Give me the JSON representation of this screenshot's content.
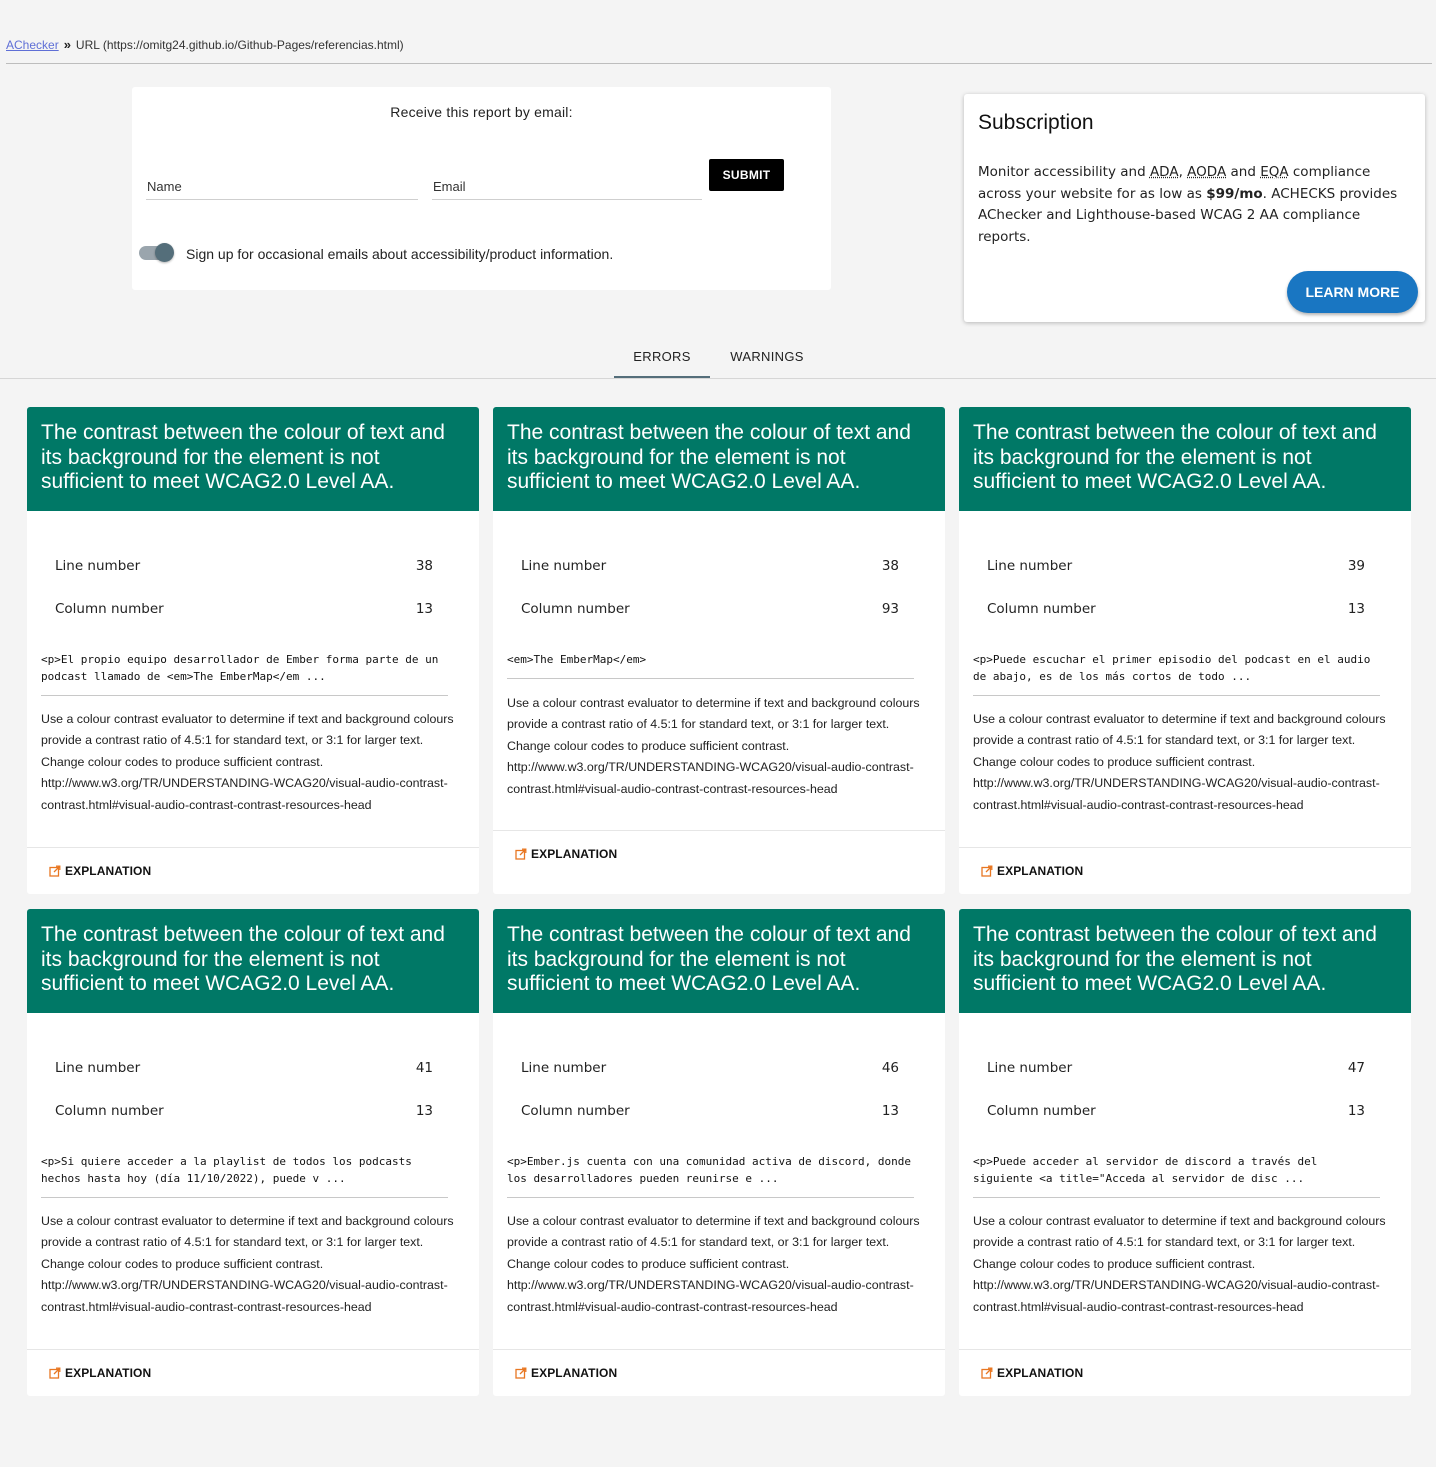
{
  "breadcrumb": {
    "link": "AChecker",
    "separator": "»",
    "current": "URL (https://omitg24.github.io/Github-Pages/referencias.html)"
  },
  "email_form": {
    "title": "Receive this report by email:",
    "name_placeholder": "Name",
    "email_placeholder": "Email",
    "submit_label": "SUBMIT",
    "toggle_label": "Sign up for occasional emails about accessibility/product information.",
    "toggle_on": true
  },
  "subscription": {
    "title": "Subscription",
    "text_before": "Monitor accessibility and ",
    "ada": "ADA",
    "comma": ", ",
    "aoda": "AODA",
    "and": " and ",
    "eqa": "EQA",
    "text_mid": " compliance across your website for as low as ",
    "price": "$99/mo",
    "text_after": ". ACHECKS provides AChecker and Lighthouse-based WCAG 2 AA compliance reports.",
    "button_label": "LEARN MORE"
  },
  "tabs": [
    {
      "label": "ERRORS",
      "active": true
    },
    {
      "label": "WARNINGS",
      "active": false
    }
  ],
  "colors": {
    "card_header": "#007866",
    "learn_more": "#1976c2",
    "explanation_icon": "#e87722"
  },
  "cards": [
    {
      "title": "The contrast between the colour of text and its background for the element is not sufficient to meet WCAG2.0 Level AA.",
      "line_label": "Line number",
      "line_value": "38",
      "col_label": "Column number",
      "col_value": "13",
      "code": "<p>El propio equipo desarrollador de Ember forma parte de un podcast llamado de <em>The EmberMap</em ...",
      "description": "Use a colour contrast evaluator to determine if text and background colours provide a contrast ratio of 4.5:1 for standard text, or 3:1 for larger text. Change colour codes to produce sufficient contrast. http://www.w3.org/TR/UNDERSTANDING-WCAG20/visual-audio-contrast-contrast.html#visual-audio-contrast-contrast-resources-head",
      "explanation": "EXPLANATION"
    },
    {
      "title": "The contrast between the colour of text and its background for the element is not sufficient to meet WCAG2.0 Level AA.",
      "line_label": "Line number",
      "line_value": "38",
      "col_label": "Column number",
      "col_value": "93",
      "code": "<em>The EmberMap</em>",
      "description": "Use a colour contrast evaluator to determine if text and background colours provide a contrast ratio of 4.5:1 for standard text, or 3:1 for larger text. Change colour codes to produce sufficient contrast. http://www.w3.org/TR/UNDERSTANDING-WCAG20/visual-audio-contrast-contrast.html#visual-audio-contrast-contrast-resources-head",
      "explanation": "EXPLANATION"
    },
    {
      "title": "The contrast between the colour of text and its background for the element is not sufficient to meet WCAG2.0 Level AA.",
      "line_label": "Line number",
      "line_value": "39",
      "col_label": "Column number",
      "col_value": "13",
      "code": "<p>Puede escuchar el primer episodio del podcast en el audio de abajo, es de los más cortos de todo ...",
      "description": "Use a colour contrast evaluator to determine if text and background colours provide a contrast ratio of 4.5:1 for standard text, or 3:1 for larger text. Change colour codes to produce sufficient contrast. http://www.w3.org/TR/UNDERSTANDING-WCAG20/visual-audio-contrast-contrast.html#visual-audio-contrast-contrast-resources-head",
      "explanation": "EXPLANATION"
    },
    {
      "title": "The contrast between the colour of text and its background for the element is not sufficient to meet WCAG2.0 Level AA.",
      "line_label": "Line number",
      "line_value": "41",
      "col_label": "Column number",
      "col_value": "13",
      "code": "<p>Si quiere acceder a la playlist de todos los podcasts hechos hasta hoy (día 11/10/2022), puede v ...",
      "description": "Use a colour contrast evaluator to determine if text and background colours provide a contrast ratio of 4.5:1 for standard text, or 3:1 for larger text. Change colour codes to produce sufficient contrast. http://www.w3.org/TR/UNDERSTANDING-WCAG20/visual-audio-contrast-contrast.html#visual-audio-contrast-contrast-resources-head",
      "explanation": "EXPLANATION"
    },
    {
      "title": "The contrast between the colour of text and its background for the element is not sufficient to meet WCAG2.0 Level AA.",
      "line_label": "Line number",
      "line_value": "46",
      "col_label": "Column number",
      "col_value": "13",
      "code": "<p>Ember.js cuenta con una comunidad activa de discord, donde los desarrolladores pueden reunirse e ...",
      "description": "Use a colour contrast evaluator to determine if text and background colours provide a contrast ratio of 4.5:1 for standard text, or 3:1 for larger text. Change colour codes to produce sufficient contrast. http://www.w3.org/TR/UNDERSTANDING-WCAG20/visual-audio-contrast-contrast.html#visual-audio-contrast-contrast-resources-head",
      "explanation": "EXPLANATION"
    },
    {
      "title": "The contrast between the colour of text and its background for the element is not sufficient to meet WCAG2.0 Level AA.",
      "line_label": "Line number",
      "line_value": "47",
      "col_label": "Column number",
      "col_value": "13",
      "code": "<p>Puede acceder al servidor de discord a través del siguiente <a title=\"Acceda al servidor de disc ...",
      "description": "Use a colour contrast evaluator to determine if text and background colours provide a contrast ratio of 4.5:1 for standard text, or 3:1 for larger text. Change colour codes to produce sufficient contrast. http://www.w3.org/TR/UNDERSTANDING-WCAG20/visual-audio-contrast-contrast.html#visual-audio-contrast-contrast-resources-head",
      "explanation": "EXPLANATION"
    }
  ]
}
